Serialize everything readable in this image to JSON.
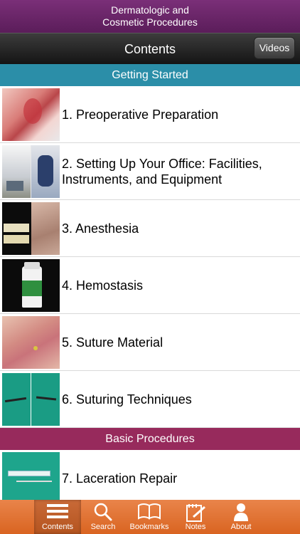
{
  "app": {
    "title_line1": "Dermatologic and",
    "title_line2": "Cosmetic Procedures"
  },
  "nav": {
    "title": "Contents",
    "videos_label": "Videos"
  },
  "sections": [
    {
      "title": "Getting Started",
      "color": "#2b8ea8",
      "items": [
        {
          "label": "1. Preoperative Preparation",
          "thumbnail": "ear-wound-photo"
        },
        {
          "label": "2. Setting Up Your Office: Facilities, Instruments, and Equipment",
          "thumbnail": "office-equipment-photo"
        },
        {
          "label": "3. Anesthesia",
          "thumbnail": "anesthesia-photo"
        },
        {
          "label": "4. Hemostasis",
          "thumbnail": "hemostatic-bottle-photo"
        },
        {
          "label": "5. Suture Material",
          "thumbnail": "skin-suture-photo"
        },
        {
          "label": "6. Suturing Techniques",
          "thumbnail": "suturing-photo"
        }
      ]
    },
    {
      "title": "Basic Procedures",
      "color": "#972a5c",
      "items": [
        {
          "label": "7. Laceration Repair",
          "thumbnail": "syringe-photo"
        }
      ]
    }
  ],
  "tabs": [
    {
      "label": "Contents",
      "icon": "list-icon",
      "selected": true
    },
    {
      "label": "Search",
      "icon": "search-icon",
      "selected": false
    },
    {
      "label": "Bookmarks",
      "icon": "book-icon",
      "selected": false
    },
    {
      "label": "Notes",
      "icon": "notepad-icon",
      "selected": false
    },
    {
      "label": "About",
      "icon": "person-icon",
      "selected": false
    }
  ],
  "colors": {
    "title_bar": "#6a2569",
    "tab_bar": "#e07232"
  }
}
